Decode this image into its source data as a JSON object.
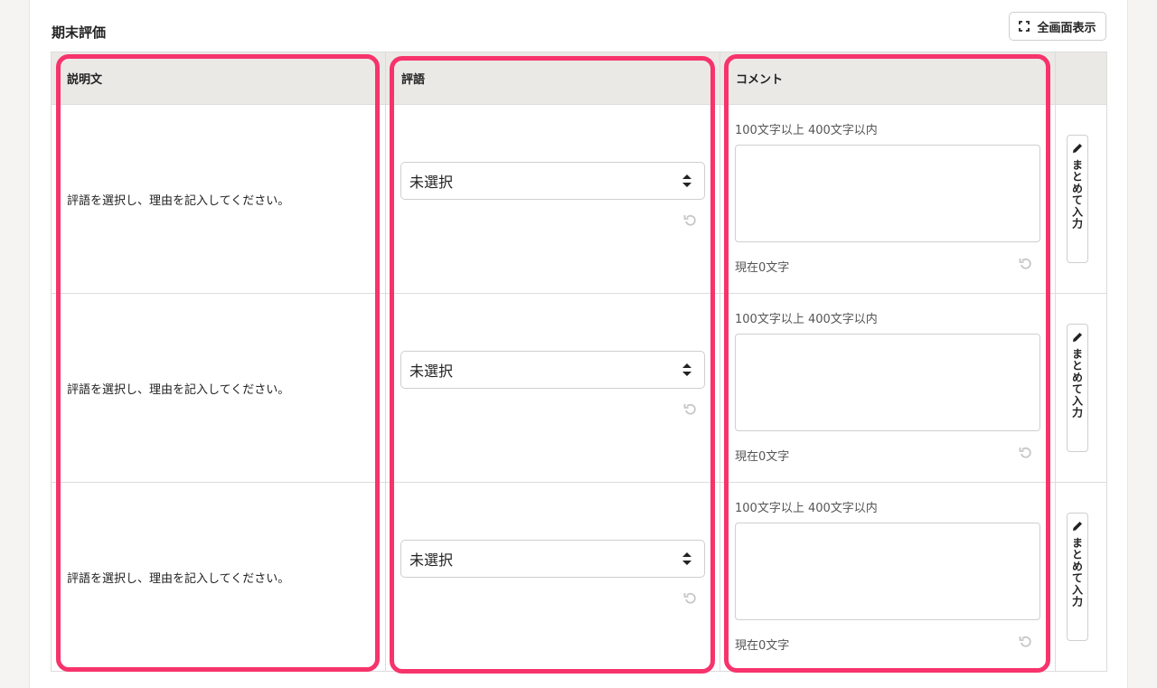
{
  "section": {
    "title": "期末評価",
    "fullscreen_label": "全画面表示"
  },
  "table": {
    "headers": {
      "description": "説明文",
      "grade": "評語",
      "comment": "コメント",
      "action": ""
    },
    "rows": [
      {
        "description": "評語を選択し、理由を記入してください。",
        "grade_value": "未選択",
        "comment_limit": "100文字以上  400文字以内",
        "comment_value": "",
        "comment_count": "現在0文字",
        "bulk_label": "まとめて入力"
      },
      {
        "description": "評語を選択し、理由を記入してください。",
        "grade_value": "未選択",
        "comment_limit": "100文字以上  400文字以内",
        "comment_value": "",
        "comment_count": "現在0文字",
        "bulk_label": "まとめて入力"
      },
      {
        "description": "評語を選択し、理由を記入してください。",
        "grade_value": "未選択",
        "comment_limit": "100文字以上  400文字以内",
        "comment_value": "",
        "comment_count": "現在0文字",
        "bulk_label": "まとめて入力"
      }
    ]
  },
  "colors": {
    "highlight": "#f7336c",
    "header_bg": "#ebe9e6",
    "page_bg": "#f5f4f2"
  },
  "icons": {
    "fullscreen": "expand-corners-icon",
    "select": "sort-arrows-icon",
    "undo": "undo-icon",
    "bulk": "pencil-icon"
  }
}
